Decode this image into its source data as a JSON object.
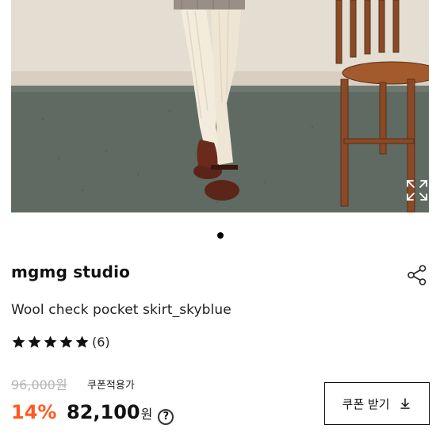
{
  "product": {
    "brand": "mgmg studio",
    "name": "Wool check pocket skirt_skyblue",
    "rating": {
      "stars": 5,
      "review_count": "(6)"
    },
    "original_price": "96,000원",
    "coupon_note": "쿠폰적용가",
    "discount_rate": "14%",
    "sale_price": "82,100",
    "currency": "원"
  },
  "gallery": {
    "slide_count": 1,
    "active_index": 0
  },
  "actions": {
    "coupon_button_label": "쿠폰 받기"
  },
  "colors": {
    "discount": "#ff5a1f",
    "strikethrough": "#b4b4b4",
    "accent": "#111111"
  },
  "icons": [
    "expand-icon",
    "share-icon",
    "star-icon",
    "help-icon",
    "download-icon"
  ]
}
